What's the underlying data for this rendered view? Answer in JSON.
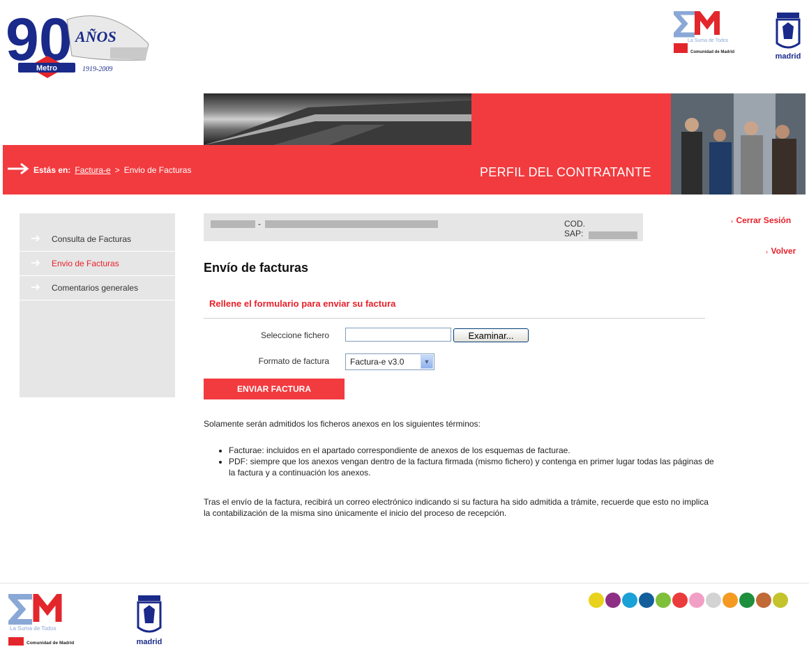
{
  "logos": {
    "anniversary_number": "90",
    "anniversary_word": "AÑOS",
    "metro_label": "Metro",
    "years": "1919-2009",
    "em_tagline": "La Suma de Todos",
    "comunidad": "Comunidad de Madrid",
    "madrid": "madrid"
  },
  "banner": {
    "breadcrumb_prefix": "Estás en:",
    "breadcrumb_link": "Factura-e",
    "breadcrumb_sep": ">",
    "breadcrumb_current": "Envio de Facturas",
    "title": "PERFIL DEL CONTRATANTE"
  },
  "sidebar": {
    "items": [
      {
        "label": "Consulta de Facturas",
        "active": false
      },
      {
        "label": "Envio de Facturas",
        "active": true
      },
      {
        "label": "Comentarios generales",
        "active": false
      }
    ]
  },
  "right_links": {
    "logout": "Cerrar Sesión",
    "back": "Volver"
  },
  "info": {
    "dash": "-",
    "cod_label": "COD.",
    "sap_label": "SAP:"
  },
  "form": {
    "title": "Envío de facturas",
    "subtitle": "Rellene el formulario para enviar su factura",
    "file_label": "Seleccione fichero",
    "file_value": "",
    "browse_label": "Examinar...",
    "format_label": "Formato de factura",
    "format_value": "Factura-e v3.0",
    "submit_label": "ENVIAR FACTURA"
  },
  "notes": {
    "intro": "Solamente serán admitidos los ficheros anexos en los siguientes términos:",
    "items": [
      "Facturae: incluidos en el apartado correspondiente de anexos de los esquemas de facturae.",
      "PDF: siempre que los anexos vengan dentro de la factura firmada (mismo fichero) y contenga en primer lugar todas las páginas de la factura y a continuación los anexos."
    ],
    "outro": "Tras el envío de la factura, recibirá un correo electrónico indicando si su factura ha sido admitida a trámite, recuerde que esto no implica la contabilización de la misma sino únicamente el inicio del proceso de recepción."
  },
  "colors": {
    "accent_red": "#f23b3f",
    "link_red": "#e8202a",
    "sidebar_gray": "#e6e6e6",
    "footer_dots": [
      "#e8d21e",
      "#8e2f86",
      "#1aa1d6",
      "#135f9c",
      "#7fbf3a",
      "#ea3c3d",
      "#f29fc5",
      "#d3d3d3",
      "#f49a23",
      "#1e8f3c",
      "#c06a38",
      "#c3c32d"
    ]
  },
  "icons": {
    "breadcrumb": "arrow-right-icon",
    "sidebar_item": "arrow-right-icon",
    "right_link": "chevron-right-icon",
    "select_dropdown": "chevron-down-icon"
  }
}
